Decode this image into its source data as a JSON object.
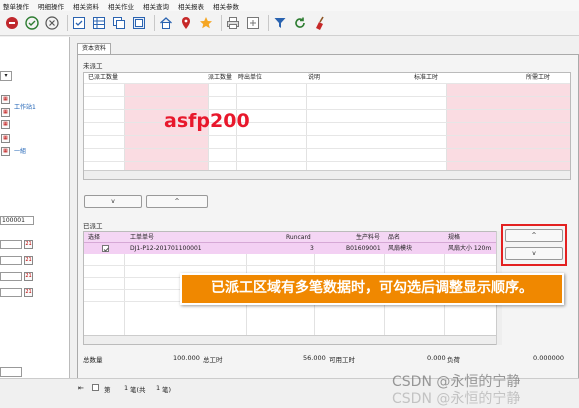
{
  "menu": [
    "整单操作",
    "明细操作",
    "相关资料",
    "相关作业",
    "相关查询",
    "相关报表",
    "相关参数"
  ],
  "toolbar_icons": [
    "stop-icon",
    "confirm-icon",
    "cancel-icon",
    "select-icon",
    "grid-icon",
    "copy-icon",
    "home-icon",
    "location-icon",
    "star-icon",
    "print-icon",
    "export-icon",
    "filter-icon",
    "refresh-icon",
    "clear-icon"
  ],
  "left": {
    "link1": "工作站1",
    "link2": "一組",
    "field_value": "100001"
  },
  "tab": {
    "label": "资本资料"
  },
  "unassigned": {
    "title": "未派工",
    "headers": [
      "已派工数量",
      "派工数量",
      "時出单位",
      "说明",
      "标准工时",
      "所需工时"
    ],
    "down_button": "v",
    "up_button": "^"
  },
  "assigned": {
    "title": "已派工",
    "headers": [
      "选择",
      "工单单号",
      "Runcard",
      "生产料号",
      "品名",
      "规格"
    ],
    "rows": [
      {
        "checked": true,
        "order_no": "DJ1-P12-201701100001",
        "runcard": "3",
        "part_no": "B01609001",
        "name": "风扇模块",
        "spec": "风扇大小 120m"
      }
    ],
    "up_button": "^",
    "down_button": "v"
  },
  "summary": {
    "total_label": "总数量",
    "total_value": "100.000",
    "total_hours_label": "总工时",
    "total_hours_value": "56.000",
    "available_label": "可用工时",
    "available_value": "0.000",
    "load_label": "负荷",
    "load_value": "0.000000"
  },
  "pager": {
    "page_label": "第",
    "page": "1",
    "total": "笔(共",
    "count": "1",
    "unit": "笔)"
  },
  "annotation": {
    "overlay_text": "asfp200",
    "banner_text": "已派工区域有多笔数据时，可勾选后调整显示顺序。"
  },
  "watermark": "CSDN @永恒的宁静",
  "colors": {
    "pink": "#fadce2",
    "magenta_row": "#f3d0f3",
    "banner": "#f08800",
    "highlight": "#e32020"
  }
}
